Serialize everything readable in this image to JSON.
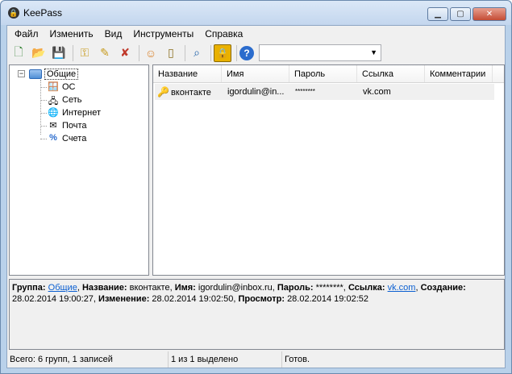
{
  "window": {
    "title": "KeePass",
    "controls": [
      "minimize",
      "maximize",
      "close"
    ]
  },
  "menu": [
    "Файл",
    "Изменить",
    "Вид",
    "Инструменты",
    "Справка"
  ],
  "toolbar": {
    "buttons": [
      "new-database-icon",
      "open-database-icon",
      "save-icon",
      "add-entry-icon",
      "edit-entry-icon",
      "delete-entry-icon",
      "user-icon",
      "copy-password-icon",
      "find-icon",
      "lock-icon",
      "help-icon"
    ],
    "quick_find_value": ""
  },
  "tree": {
    "root": "Общие",
    "children": [
      "ОС",
      "Сеть",
      "Интернет",
      "Почта",
      "Счета"
    ]
  },
  "list": {
    "columns": [
      "Название",
      "Имя",
      "Пароль",
      "Ссылка",
      "Комментарии"
    ],
    "rows": [
      [
        "вконтакте",
        "igordulin@in...",
        "********",
        "vk.com",
        ""
      ]
    ]
  },
  "details": {
    "group_label": "Группа:",
    "group_value": "Общие",
    "title_label": "Название:",
    "title_value": "вконтакте,",
    "user_label": "Имя:",
    "user_value": "igordulin@inbox.ru,",
    "pass_label": "Пароль:",
    "pass_value": "********,",
    "url_label": "Ссылка:",
    "url_value": "vk.com",
    "created_label": "Создание:",
    "created_value": "28.02.2014 19:00:27,",
    "modified_label": "Изменение:",
    "modified_value": "28.02.2014 19:02:50,",
    "accessed_label": "Просмотр:",
    "accessed_value": "28.02.2014 19:02:52"
  },
  "status": {
    "totals": "Всего: 6 групп, 1 записей",
    "selection": "1 из 1 выделено",
    "state": "Готов."
  },
  "colors": {
    "frame": "#b9d1ea",
    "link": "#0b5fd1"
  }
}
